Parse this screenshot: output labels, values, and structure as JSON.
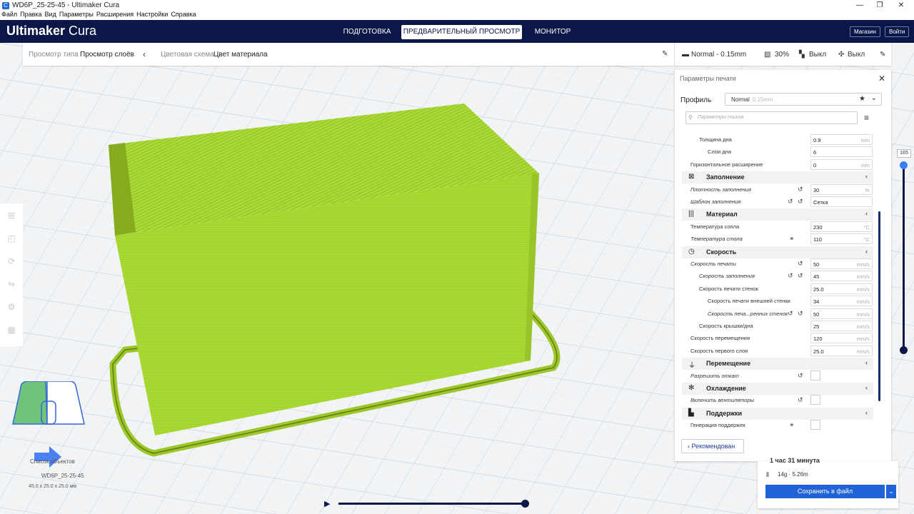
{
  "window": {
    "title": "WD6P_25-25-45 - Ultimaker Cura",
    "menu": [
      "Файл",
      "Правка",
      "Вид",
      "Параметры",
      "Расширения",
      "Настройки",
      "Справка"
    ]
  },
  "header": {
    "brand_bold": "Ultimaker",
    "brand_light": " Cura",
    "tabs": [
      "ПОДГОТОВКА",
      "ПРЕДВАРИТЕЛЬНЫЙ ПРОСМОТР",
      "МОНИТОР"
    ],
    "active_tab": "ПРЕДВАРИТЕЛЬНЫЙ ПРОСМОТР",
    "store_button": "Магазин",
    "login_button": "Войти"
  },
  "viewbar": {
    "view_type_label": "Просмотр типа",
    "view_type_value": "Просмотр слоёв",
    "color_scheme_label": "Цветовая схема",
    "color_scheme_value": "Цвет материала"
  },
  "printbar": {
    "profile": "Normal - 0.15mm",
    "infill": "30%",
    "support": "Выкл",
    "adhesion": "Выкл"
  },
  "panel": {
    "title": "Параметры печати",
    "profile_label": "Профиль",
    "profile_value": "Normal",
    "profile_sub": "0.15mm",
    "search_placeholder": "Параметры поиска",
    "rows": [
      {
        "name": "Толщина дна",
        "value": "0.9",
        "unit": "mm"
      },
      {
        "name": "Слои дна",
        "value": "6",
        "unit": ""
      },
      {
        "name": "Горизонтальное расширение",
        "value": "0",
        "unit": "mm"
      },
      {
        "category": "Заполнение"
      },
      {
        "name": "Плотность заполнения",
        "value": "30",
        "unit": "%"
      },
      {
        "name": "Шаблон заполнения",
        "value": "Сетка",
        "unit": ""
      },
      {
        "category": "Материал"
      },
      {
        "name": "Температура сопла",
        "value": "230",
        "unit": "°C"
      },
      {
        "name": "Температура стола",
        "value": "110",
        "unit": "°C"
      },
      {
        "category": "Скорость"
      },
      {
        "name": "Скорость печати",
        "value": "50",
        "unit": "mm/s"
      },
      {
        "name": "Скорость заполнения",
        "value": "45",
        "unit": "mm/s"
      },
      {
        "name": "Скорость печати стенок",
        "value": "25.0",
        "unit": "mm/s"
      },
      {
        "name": "Скорость печати внешней стенки",
        "value": "34",
        "unit": "mm/s"
      },
      {
        "name": "Скорость печа...ренних стенок",
        "value": "50",
        "unit": "mm/s"
      },
      {
        "name": "Скорость крышки/дна",
        "value": "25",
        "unit": "mm/s"
      },
      {
        "name": "Скорость перемещения",
        "value": "120",
        "unit": "mm/s"
      },
      {
        "name": "Скорость первого слоя",
        "value": "25.0",
        "unit": "mm/s"
      },
      {
        "category": "Перемещение"
      },
      {
        "name": "Разрешить откат",
        "value": "",
        "unit": ""
      },
      {
        "category": "Охлаждение"
      },
      {
        "name": "Включить вентиляторы",
        "value": "",
        "unit": ""
      },
      {
        "category": "Поддержки"
      },
      {
        "name": "Генерация поддержек",
        "value": "",
        "unit": ""
      }
    ],
    "recommended_button": "Рекомендован"
  },
  "layer_slider": {
    "current": "165"
  },
  "save": {
    "time": "1 час 31 минута",
    "material": "14g · 5.26m",
    "button": "Сохранить в файл"
  },
  "objects": {
    "header": "Список объектов",
    "name": "WD6P_25-25-45",
    "size": "45.0 x 25.0 x 25.0 мм"
  },
  "colors": {
    "header_bg": "#0b1847",
    "model_green": "#a8d932",
    "accent_blue": "#1f63d6"
  }
}
